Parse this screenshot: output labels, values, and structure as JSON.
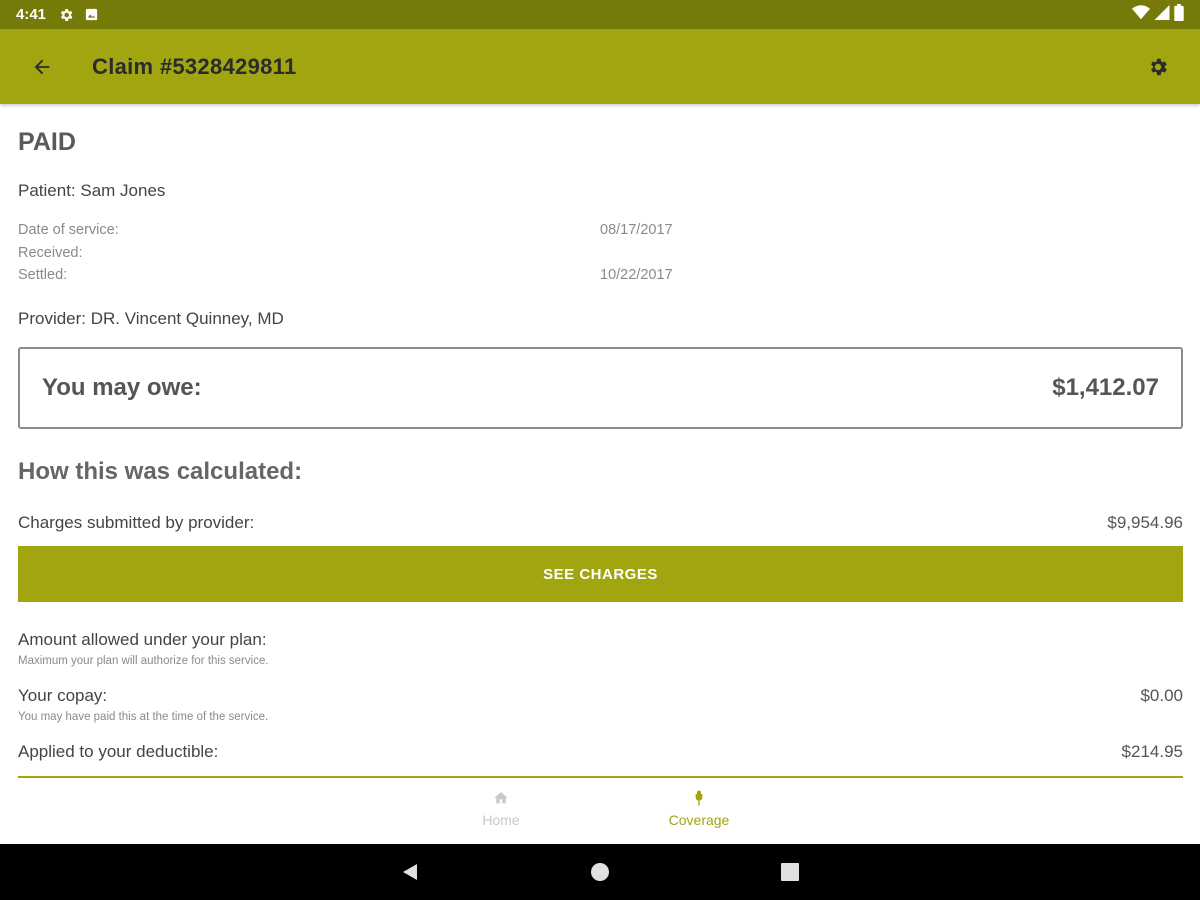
{
  "status_bar": {
    "time": "4:41"
  },
  "app_bar": {
    "title": "Claim #5328429811"
  },
  "claim": {
    "status": "PAID",
    "patient": "Patient: Sam Jones",
    "dates": [
      {
        "label": "Date of service:",
        "value": "08/17/2017"
      },
      {
        "label": "Received:",
        "value": ""
      },
      {
        "label": "Settled:",
        "value": "10/22/2017"
      }
    ],
    "provider": "Provider: DR. Vincent Quinney, MD"
  },
  "owe": {
    "label": "You may owe:",
    "value": "$1,412.07"
  },
  "calculation": {
    "heading": "How this was calculated:",
    "charges_label": "Charges submitted by provider:",
    "charges_value": "$9,954.96",
    "see_charges_label": "SEE CHARGES",
    "allowed_label": "Amount allowed under your plan:",
    "allowed_note": "Maximum your plan will authorize for this service.",
    "copay_label": "Your copay:",
    "copay_note": "You may have paid this at the time of the service.",
    "copay_value": "$0.00",
    "deductible_label": "Applied to your deductible:",
    "deductible_value": "$214.95"
  },
  "bottom_nav": {
    "home_label": "Home",
    "coverage_label": "Coverage"
  },
  "colors": {
    "accent": "#a1a510",
    "status_bar": "#767a08"
  }
}
